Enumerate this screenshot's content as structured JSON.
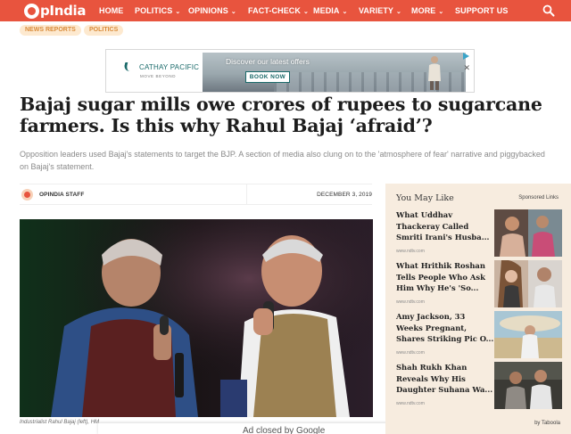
{
  "site": {
    "logo_text": "pIndia"
  },
  "nav": {
    "items": [
      {
        "label": "HOME",
        "chevron": false
      },
      {
        "label": "POLITICS",
        "chevron": true
      },
      {
        "label": "OPINIONS",
        "chevron": true
      },
      {
        "label": "FACT-CHECK",
        "chevron": true
      },
      {
        "label": "MEDIA",
        "chevron": true
      },
      {
        "label": "VARIETY",
        "chevron": true
      },
      {
        "label": "MORE",
        "chevron": true
      },
      {
        "label": "SUPPORT US",
        "chevron": false
      }
    ],
    "search_icon": "search-icon"
  },
  "tags": [
    "NEWS REPORTS",
    "POLITICS"
  ],
  "ad": {
    "brand": "CATHAY PACIFIC",
    "tagline": "MOVE BEYOND",
    "headline": "Discover our latest offers",
    "button": "BOOK NOW",
    "close_icon": "close-icon",
    "choices_icon": "ad-choices-icon"
  },
  "article": {
    "headline": "Bajaj sugar mills owe crores of rupees to sugarcane farmers. Is this why Rahul Bajaj ‘afraid’?",
    "standfirst": "Opposition leaders used Bajaj's statements to target the BJP. A section of media also clung on to the 'atmosphere of fear' narrative and piggybacked on Bajaj's statement.",
    "author": "OPINDIA STAFF",
    "date": "DECEMBER 3, 2019",
    "caption": "Industrialist Rahul Bajaj (left), HM"
  },
  "ad_closed": {
    "text": "Ad closed by Google"
  },
  "sidebar": {
    "title": "You May Like",
    "sponsored": "Sponsored Links",
    "footer": "by Taboola",
    "items": [
      {
        "title": "What Uddhav Thackeray Called Smriti Irani's Husba...",
        "source": "www.ndtv.com"
      },
      {
        "title": "What Hrithik Roshan Tells People Who Ask Him Why He's 'So...",
        "source": "www.ndtv.com"
      },
      {
        "title": "Amy Jackson, 33 Weeks Pregnant, Shares Striking Pic O...",
        "source": "www.ndtv.com"
      },
      {
        "title": "Shah Rukh Khan Reveals Why His Daughter Suhana Wa...",
        "source": "www.ndtv.com"
      }
    ]
  },
  "colors": {
    "brand": "#e8543e",
    "tag_bg": "#fde9cf",
    "tag_text": "#d98b3a",
    "sidebar_bg": "#f7ecdf"
  }
}
